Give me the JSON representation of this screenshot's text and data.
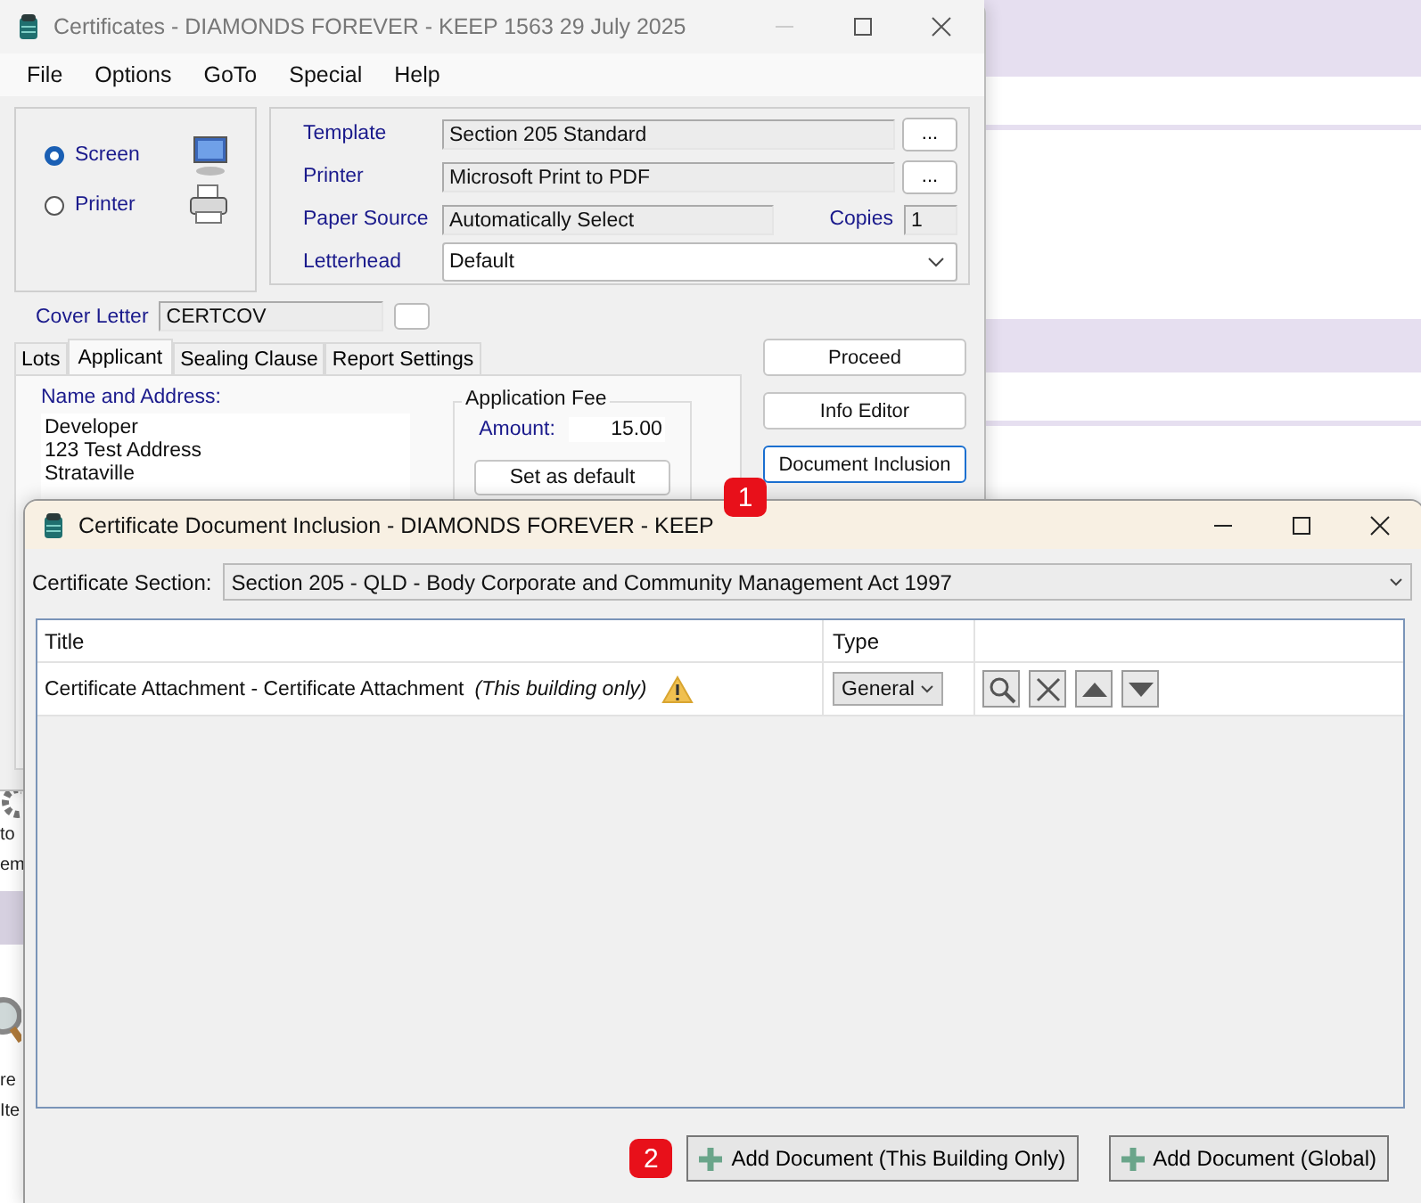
{
  "background_app": {
    "fragments": [
      "to",
      "em",
      "re",
      "Ite"
    ]
  },
  "main_window": {
    "title": "Certificates - DIAMONDS FOREVER - KEEP 1563 29 July 2025",
    "menu": [
      "File",
      "Options",
      "GoTo",
      "Special",
      "Help"
    ],
    "output": [
      {
        "label": "Screen",
        "selected": true,
        "kind": "screen"
      },
      {
        "label": "Printer",
        "selected": false,
        "kind": "printer"
      }
    ],
    "fields": [
      {
        "kind": "browse",
        "label": "Template",
        "value": "Section 205 Standard",
        "button": "..."
      },
      {
        "kind": "browse",
        "label": "Printer",
        "value": "Microsoft Print to PDF",
        "button": "..."
      },
      {
        "kind": "copies",
        "label": "Paper Source",
        "value": "Automatically Select",
        "copies_label": "Copies",
        "copies": "1"
      },
      {
        "kind": "dropdown",
        "label": "Letterhead",
        "value": "Default"
      }
    ],
    "cover_letter": {
      "label": "Cover Letter",
      "value": "CERTCOV"
    },
    "tabs": [
      {
        "label": "Lots",
        "selected": false
      },
      {
        "label": "Applicant",
        "selected": true
      },
      {
        "label": "Sealing Clause",
        "selected": false
      },
      {
        "label": "Report Settings",
        "selected": false
      }
    ],
    "name_address": {
      "label": "Name and Address:",
      "lines": [
        "Developer",
        "123 Test Address",
        "Strataville"
      ]
    },
    "application_fee": {
      "title": "Application Fee",
      "amount_label": "Amount:",
      "amount": "15.00",
      "button": "Set as default"
    },
    "actions": [
      {
        "label": "Proceed",
        "focused": false
      },
      {
        "label": "Info Editor",
        "focused": false
      },
      {
        "label": "Document Inclusion",
        "focused": true,
        "callout": "1"
      }
    ]
  },
  "dialog": {
    "title": "Certificate Document Inclusion - DIAMONDS FOREVER - KEEP",
    "section_label": "Certificate Section:",
    "section": "Section 205 - QLD - Body Corporate and Community Management Act 1997",
    "columns": [
      "Title",
      "Type"
    ],
    "rows": [
      {
        "title": "Certificate Attachment - Certificate Attachment",
        "scope": "(This building only)",
        "warning": true,
        "type": "General"
      }
    ],
    "buttons": [
      {
        "label": "Add Document (This Building Only)",
        "callout": "2"
      },
      {
        "label": "Add Document (Global)"
      }
    ]
  }
}
